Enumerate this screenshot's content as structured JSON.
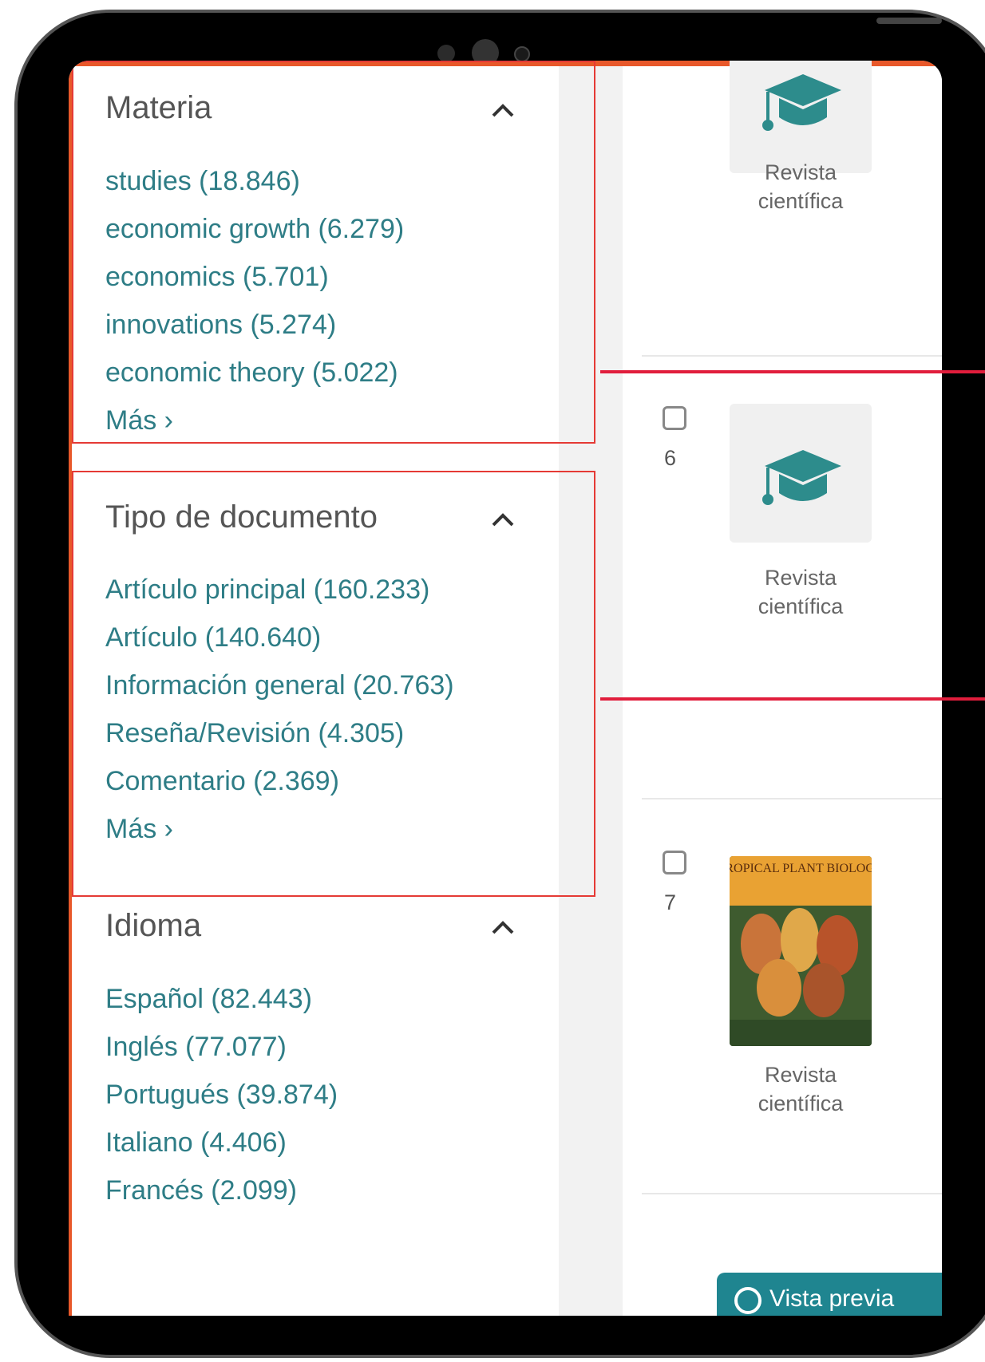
{
  "facets": [
    {
      "title": "Materia",
      "items": [
        "studies (18.846)",
        "economic growth (6.279)",
        "economics (5.701)",
        "innovations (5.274)",
        "economic theory (5.022)"
      ],
      "more_label": "Más ›"
    },
    {
      "title": "Tipo de documento",
      "items": [
        "Artículo principal (160.233)",
        "Artículo (140.640)",
        "Información general (20.763)",
        "Reseña/Revisión (4.305)",
        "Comentario (2.369)"
      ],
      "more_label": "Más ›"
    },
    {
      "title": "Idioma",
      "items": [
        "Español (82.443)",
        "Inglés (77.077)",
        "Portugués (39.874)",
        "Italiano (4.406)",
        "Francés (2.099)"
      ]
    }
  ],
  "results": [
    {
      "type_line1": "Revista",
      "type_line2": "científica"
    },
    {
      "number": "6",
      "type_line1": "Revista",
      "type_line2": "científica"
    },
    {
      "number": "7",
      "type_line1": "Revista",
      "type_line2": "científica",
      "cover_title": "TROPICAL PLANT BIOLOGY"
    }
  ],
  "view_button_label": "Vista previa",
  "colors": {
    "accent": "#e8582a",
    "link": "#2e7d86",
    "highlight": "#e53a35",
    "callout": "#e11d3c",
    "button": "#1f8590"
  },
  "icons": {
    "chevron": "chevron-up-icon",
    "cap": "graduation-cap-icon"
  }
}
